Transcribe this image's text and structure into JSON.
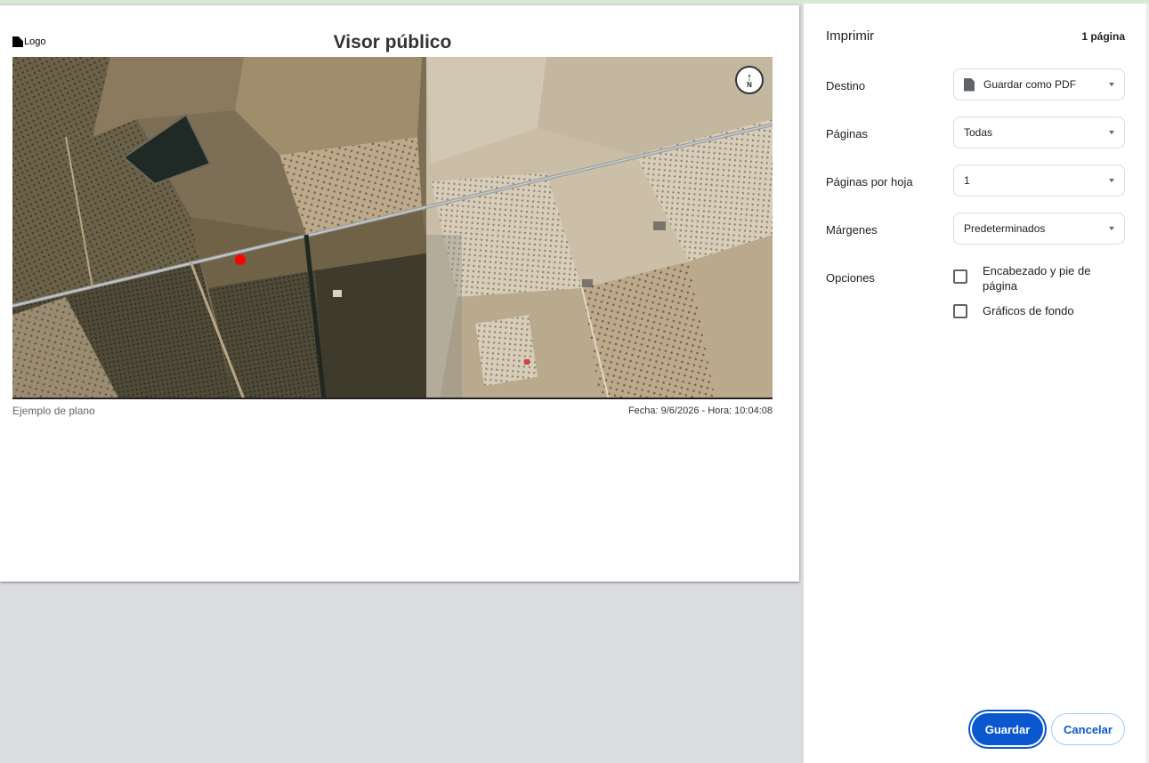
{
  "preview": {
    "logo_text": "Logo",
    "title": "Visor público",
    "subtitle": "Ejemplo de plano",
    "date_line": "Fecha: 9/6/2026 - Hora: 10:04:08",
    "north_label": "N",
    "north_arrow": "↑"
  },
  "panel": {
    "title": "Imprimir",
    "page_count": "1 página",
    "destination": {
      "label": "Destino",
      "value": "Guardar como PDF",
      "icon": "document-icon"
    },
    "pages": {
      "label": "Páginas",
      "value": "Todas"
    },
    "pages_per_sheet": {
      "label": "Páginas por hoja",
      "value": "1"
    },
    "margins": {
      "label": "Márgenes",
      "value": "Predeterminados"
    },
    "options": {
      "label": "Opciones",
      "header_footer": "Encabezado y pie de página",
      "background_graphics": "Gráficos de fondo"
    },
    "save_button": "Guardar",
    "cancel_button": "Cancelar"
  },
  "colors": {
    "accent": "#0b57d0",
    "marker": "#ff0000"
  }
}
